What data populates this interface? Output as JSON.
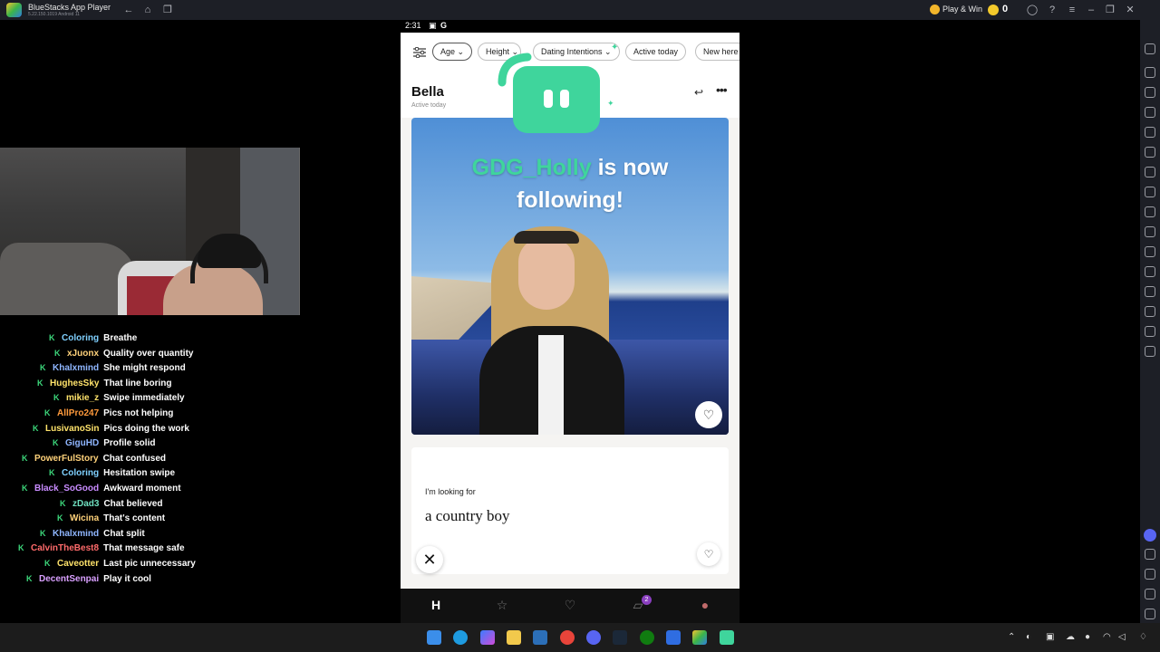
{
  "window": {
    "app_name": "BlueStacks App Player",
    "app_version": "5.22.150.1019  Android 11",
    "play_win_label": "Play & Win",
    "coin_count": "0"
  },
  "phone": {
    "status_time": "2:31",
    "filters": [
      "Age",
      "Height",
      "Dating Intentions",
      "Active today",
      "New here"
    ],
    "profile": {
      "name": "Bella",
      "active_status": "Active today"
    },
    "overlay": {
      "follower_name": "GDG_Holly",
      "follow_text_1": "is now",
      "follow_text_2": "following!"
    },
    "prompt": {
      "label": "I'm looking for",
      "answer": "a country boy"
    },
    "nav": {
      "messages_badge": "2"
    }
  },
  "chat": [
    {
      "user": "Coloring",
      "color": "#7fd0ff",
      "msg": "Breathe"
    },
    {
      "user": "xJuonx",
      "color": "#ffd27a",
      "msg": "Quality over quantity"
    },
    {
      "user": "Khalxmind",
      "color": "#8fb6ff",
      "msg": "She might respond"
    },
    {
      "user": "HughesSky",
      "color": "#ffe36b",
      "msg": "That line boring"
    },
    {
      "user": "mikie_z",
      "color": "#ffe36b",
      "msg": "Swipe immediately"
    },
    {
      "user": "AllPro247",
      "color": "#ff9a3c",
      "msg": "Pics not helping"
    },
    {
      "user": "LusivanoSin",
      "color": "#ffe36b",
      "msg": "Pics doing the work"
    },
    {
      "user": "GiguHD",
      "color": "#8fb6ff",
      "msg": "Profile solid"
    },
    {
      "user": "PowerFulStory",
      "color": "#ffd27a",
      "msg": "Chat confused"
    },
    {
      "user": "Coloring",
      "color": "#7fd0ff",
      "msg": "Hesitation swipe"
    },
    {
      "user": "Black_SoGood",
      "color": "#c98cff",
      "msg": "Awkward moment"
    },
    {
      "user": "zDad3",
      "color": "#6fe0c0",
      "msg": "Chat believed"
    },
    {
      "user": "Wicina",
      "color": "#ffd27a",
      "msg": "That's content"
    },
    {
      "user": "Khalxmind",
      "color": "#8fb6ff",
      "msg": "Chat split"
    },
    {
      "user": "CalvinTheBest8",
      "color": "#ff6b6b",
      "msg": "That message safe"
    },
    {
      "user": "Caveotter",
      "color": "#ffe36b",
      "msg": "Last pic unnecessary"
    },
    {
      "user": "DecentSenpai",
      "color": "#d9a0ff",
      "msg": "Play it cool"
    }
  ],
  "colors": {
    "accent_green": "#3fd59c",
    "badge_purple": "#8a3fbf"
  }
}
